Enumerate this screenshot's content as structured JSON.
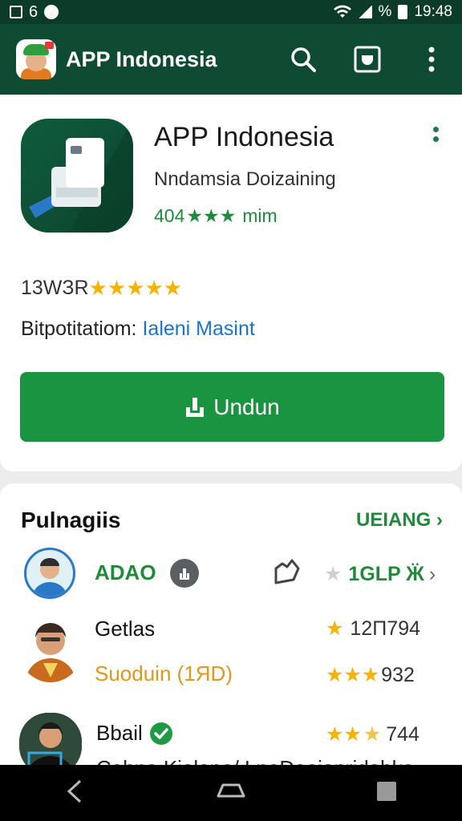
{
  "status": {
    "left_num": "6",
    "battery_pct": "%",
    "time": "19:48"
  },
  "appbar": {
    "title": "APP Indonesia"
  },
  "app": {
    "title": "APP Indonesia",
    "subtitle": "Nndamsia Doizaining",
    "rating_text": "404",
    "rating_suffix": "mim",
    "reviews_count": "13WЗR",
    "distribution_label": "Bitpotitatiom:",
    "distribution_link": "Ialeni Masint",
    "install_label": "Undun"
  },
  "reviews_section": {
    "title": "Pulnagiis",
    "more_label": "UEIANG",
    "items": [
      {
        "name": "ADAO",
        "meta": "1GLP Ӝ"
      },
      {
        "name": "Getlas",
        "meta": "12Π794",
        "sub": "Suoduin (1ЯD)",
        "sub_meta": "932"
      },
      {
        "name": "Bbail",
        "meta": "744",
        "sub": "Cabna Kiolane/ LneDoeianridabke"
      }
    ]
  },
  "colors": {
    "primary_dark": "#0f4a33",
    "accent_green": "#1a9440",
    "star": "#f6b300",
    "link": "#1a73c8"
  }
}
